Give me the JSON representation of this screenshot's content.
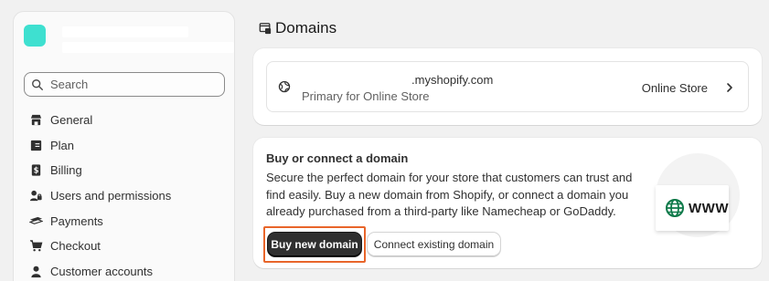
{
  "sidebar": {
    "search": {
      "placeholder": "Search",
      "icon": "search-icon"
    },
    "items": [
      {
        "label": "General",
        "icon": "store-icon"
      },
      {
        "label": "Plan",
        "icon": "plan-icon"
      },
      {
        "label": "Billing",
        "icon": "billing-icon"
      },
      {
        "label": "Users and permissions",
        "icon": "users-icon"
      },
      {
        "label": "Payments",
        "icon": "payments-icon"
      },
      {
        "label": "Checkout",
        "icon": "cart-icon"
      },
      {
        "label": "Customer accounts",
        "icon": "person-icon"
      }
    ],
    "avatar_color": "#3ee0d0"
  },
  "main": {
    "title": "Domains",
    "primary_domain": {
      "name": ".myshopify.com",
      "subtitle": "Primary for Online Store",
      "target": "Online Store"
    },
    "buy_card": {
      "title": "Buy or connect a domain",
      "description": "Secure the perfect domain for your store that customers can trust and find easily. Buy a new domain from Shopify, or connect a domain you already purchased from a third-party like Namecheap or GoDaddy.",
      "illustration_text": "WWW",
      "primary_button": "Buy new domain",
      "secondary_button": "Connect existing domain"
    },
    "highlight_color": "#e8652a"
  }
}
